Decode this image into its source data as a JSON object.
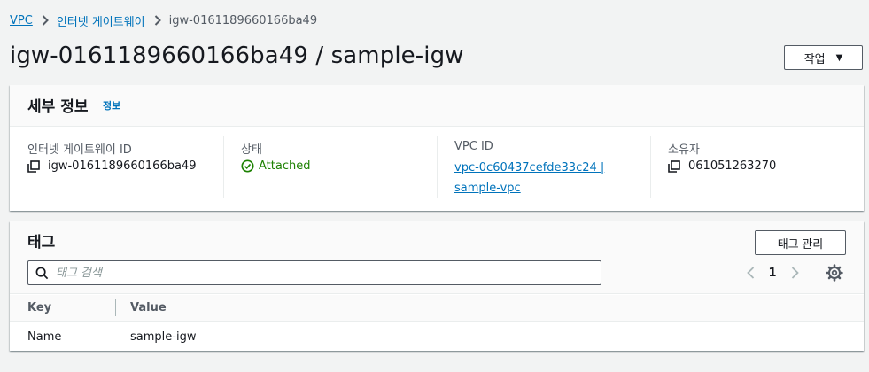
{
  "breadcrumb": {
    "items": [
      "VPC",
      "인터넷 게이트웨이"
    ],
    "current": "igw-0161189660166ba49"
  },
  "header": {
    "title": "igw-0161189660166ba49 / sample-igw",
    "actions_label": "작업"
  },
  "details": {
    "title": "세부 정보",
    "info_label": "정보",
    "fields": {
      "igw_id": {
        "label": "인터넷 게이트웨이 ID",
        "value": "igw-0161189660166ba49"
      },
      "state": {
        "label": "상태",
        "value": "Attached"
      },
      "vpc_id": {
        "label": "VPC ID",
        "value": "vpc-0c60437cefde33c24 | sample-vpc"
      },
      "owner": {
        "label": "소유자",
        "value": "061051263270"
      }
    }
  },
  "tags": {
    "title": "태그",
    "manage_label": "태그 관리",
    "search_placeholder": "태그 검색",
    "page": "1",
    "columns": [
      "Key",
      "Value"
    ],
    "rows": [
      {
        "key": "Name",
        "value": "sample-igw"
      }
    ]
  },
  "colors": {
    "link": "#0073bb",
    "success": "#1d8102",
    "text": "#16191f",
    "muted": "#545b64",
    "background": "#f2f3f3"
  }
}
